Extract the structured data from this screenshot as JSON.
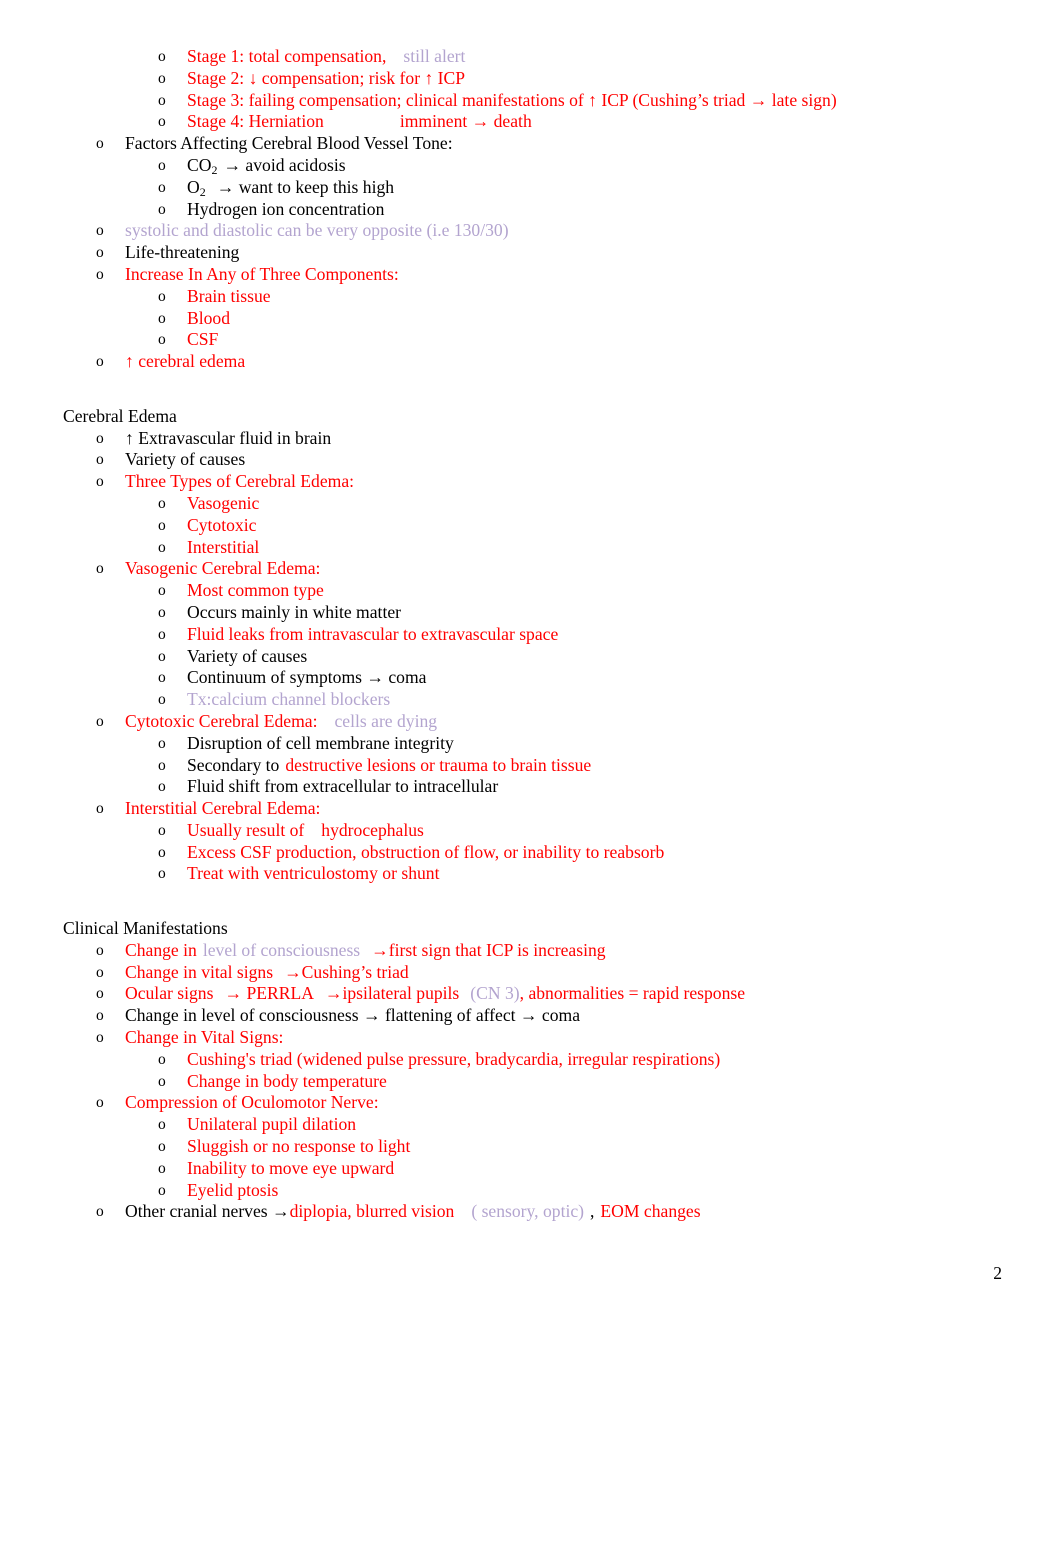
{
  "document": {
    "page_number": "2",
    "bullet_glyph": "o",
    "colors": {
      "red": "#ff0000",
      "black": "#000000",
      "lavender": "#b3a4cf"
    }
  },
  "content": {
    "icp_stages": {
      "stage1_main": "Stage 1: total compensation,",
      "stage1_note": "still alert",
      "stage2": "Stage 2: ↓ compensation; risk for ↑ ICP",
      "stage3": "Stage 3: failing compensation; clinical manifestations of ↑ ICP (Cushing’s triad → late sign)",
      "stage4_main": "Stage 4: Herniation",
      "stage4_tail": "imminent → death"
    },
    "blood_vessel_tone": {
      "header": "Factors Affecting Cerebral Blood Vessel Tone:",
      "co2_prefix": "CO",
      "co2_sub": "2",
      "co2_suffix": "→ avoid acidosis",
      "o2_prefix": "O",
      "o2_sub": "2",
      "o2_suffix": "→ want to keep this high",
      "hydrogen": "Hydrogen ion concentration"
    },
    "icp_general": {
      "systolic_note": "systolic and diastolic can be very opposite (i.e 130/30)",
      "life_threatening": "Life-threatening",
      "increase_header": "Increase In Any of Three Components:",
      "components": [
        "Brain tissue",
        "Blood",
        "CSF"
      ],
      "cerebral_edema_arrow": "↑ cerebral edema"
    },
    "cerebral_edema": {
      "heading": "Cerebral Edema",
      "extravascular": "↑ Extravascular fluid in brain",
      "variety_of_causes": "Variety of causes",
      "three_types_header": "Three Types of Cerebral Edema:",
      "three_types": [
        "Vasogenic",
        "Cytotoxic",
        "Interstitial"
      ],
      "vasogenic": {
        "header": "Vasogenic Cerebral Edema:",
        "most_common": "Most common type",
        "white_matter": "Occurs mainly in white matter",
        "fluid_leaks": "Fluid leaks from intravascular to extravascular space",
        "variety": "Variety of causes",
        "continuum": "Continuum of symptoms → coma",
        "tx_note": "Tx:calcium channel blockers"
      },
      "cytotoxic": {
        "header": "Cytotoxic Cerebral Edema:",
        "header_note": "cells are dying",
        "disruption": "Disruption of  cell membrane integrity",
        "secondary_prefix": "Secondary to",
        "secondary_red": "destructive lesions or trauma to brain tissue",
        "fluid_shift": "Fluid shift from extracellular to intracellular"
      },
      "interstitial": {
        "header": "Interstitial Cerebral Edema:",
        "usually_result_prefix": "Usually result of",
        "usually_result_tail": "hydrocephalus",
        "excess_csf": "Excess CSF production, obstruction of flow, or inability to reabsorb",
        "treat": "Treat with ventriculostomy or shunt"
      }
    },
    "clinical_manifestations": {
      "heading": "Clinical Manifestations",
      "change_loc_prefix": "Change in",
      "change_loc_lav": "level of consciousness",
      "change_loc_tail": "→first sign that ICP is increasing",
      "change_vitals": "Change in vital signs",
      "change_vitals_tail": "→Cushing’s triad",
      "ocular_prefix": "Ocular signs",
      "ocular_mid": "→ PERRLA",
      "ocular_mid2": "→ipsilateral pupils",
      "ocular_lav": "(CN 3)",
      "ocular_tail": ", abnormalities = rapid response",
      "change_loc_black": "Change in level of consciousness → flattening of affect → coma",
      "vital_signs_header": "Change in Vital Signs:",
      "cushings_triad": "Cushing's triad (widened pulse pressure, bradycardia, irregular respirations)",
      "body_temp": "Change in body temperature",
      "oculomotor_header": "Compression of Oculomotor Nerve:",
      "oculomotor_items": [
        "Unilateral pupil dilation",
        "Sluggish or no response to light",
        "Inability to move eye upward",
        "Eyelid ptosis"
      ],
      "other_nerves_prefix": "Other cranial nerves →",
      "other_nerves_red": "diplopia, blurred vision",
      "other_nerves_lav": "( sensory, optic)",
      "other_nerves_comma": ",",
      "other_nerves_tail": "EOM changes"
    }
  }
}
